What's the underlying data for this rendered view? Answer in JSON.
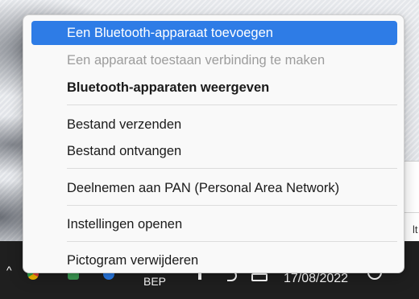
{
  "menu": {
    "items": [
      {
        "label": "Een Bluetooth-apparaat toevoegen",
        "state": "selected"
      },
      {
        "label": "Een apparaat toestaan verbinding te maken",
        "state": "disabled"
      },
      {
        "label": "Bluetooth-apparaten weergeven",
        "state": "default-bold"
      },
      {
        "label": "Bestand verzenden",
        "state": "normal"
      },
      {
        "label": "Bestand ontvangen",
        "state": "normal"
      },
      {
        "label": "Deelnemen aan PAN (Personal Area Network)",
        "state": "normal"
      },
      {
        "label": "Instellingen openen",
        "state": "normal"
      },
      {
        "label": "Pictogram verwijderen",
        "state": "normal"
      }
    ]
  },
  "taskbar": {
    "language": "BEP",
    "date": "17/08/2022",
    "tray_icons": [
      "chevron-up-icon",
      "chrome-icon",
      "security-icon",
      "bluetooth-icon",
      "wifi-icon",
      "volume-icon",
      "battery-icon",
      "notification-icon"
    ]
  },
  "background_window": {
    "visible_text": "lt"
  },
  "colors": {
    "selected_bg": "#2e7ce6",
    "menu_bg": "#f9f9f9",
    "taskbar_bg": "#1f1f1f",
    "disabled_text": "#9c9c9c"
  }
}
